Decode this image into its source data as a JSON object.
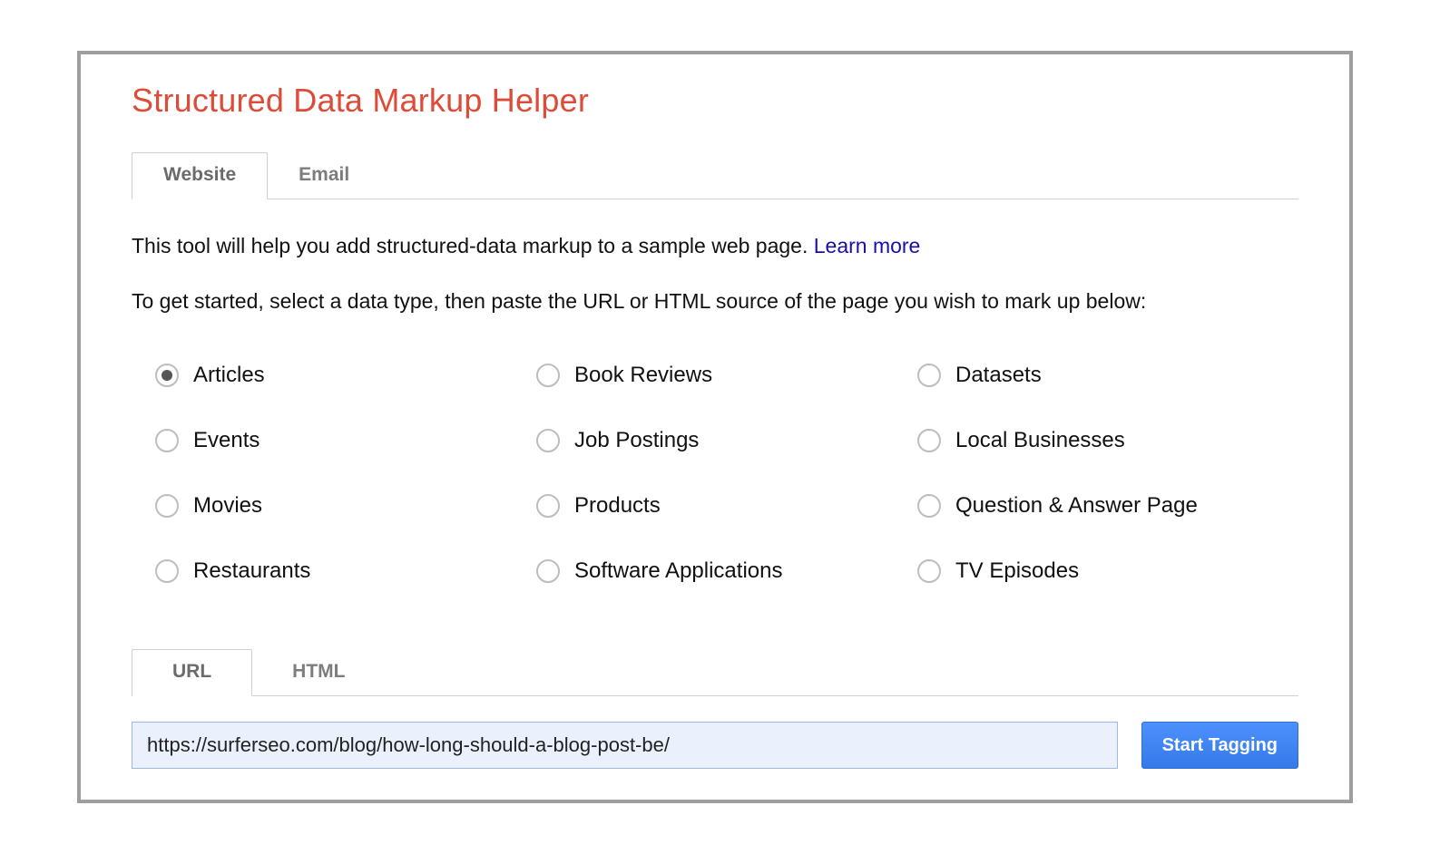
{
  "title": "Structured Data Markup Helper",
  "tabs": {
    "website": "Website",
    "email": "Email",
    "active": "website"
  },
  "intro_text": "This tool will help you add structured-data markup to a sample web page. ",
  "learn_more": "Learn more",
  "lead_text": "To get started, select a data type, then paste the URL or HTML source of the page you wish to mark up below:",
  "data_types": [
    {
      "id": "articles",
      "label": "Articles",
      "selected": true
    },
    {
      "id": "book-reviews",
      "label": "Book Reviews",
      "selected": false
    },
    {
      "id": "datasets",
      "label": "Datasets",
      "selected": false
    },
    {
      "id": "events",
      "label": "Events",
      "selected": false
    },
    {
      "id": "job-postings",
      "label": "Job Postings",
      "selected": false
    },
    {
      "id": "local-businesses",
      "label": "Local Businesses",
      "selected": false
    },
    {
      "id": "movies",
      "label": "Movies",
      "selected": false
    },
    {
      "id": "products",
      "label": "Products",
      "selected": false
    },
    {
      "id": "qa-page",
      "label": "Question & Answer Page",
      "selected": false
    },
    {
      "id": "restaurants",
      "label": "Restaurants",
      "selected": false
    },
    {
      "id": "software-apps",
      "label": "Software Applications",
      "selected": false
    },
    {
      "id": "tv-episodes",
      "label": "TV Episodes",
      "selected": false
    }
  ],
  "source_tabs": {
    "url": "URL",
    "html": "HTML",
    "active": "url"
  },
  "url_field": {
    "value": "https://surferseo.com/blog/how-long-should-a-blog-post-be/"
  },
  "start_button": "Start Tagging",
  "colors": {
    "title": "#dd4b39",
    "link": "#1a0dab",
    "button_bg": "#4d90fe",
    "input_bg": "#eaf1fd"
  }
}
